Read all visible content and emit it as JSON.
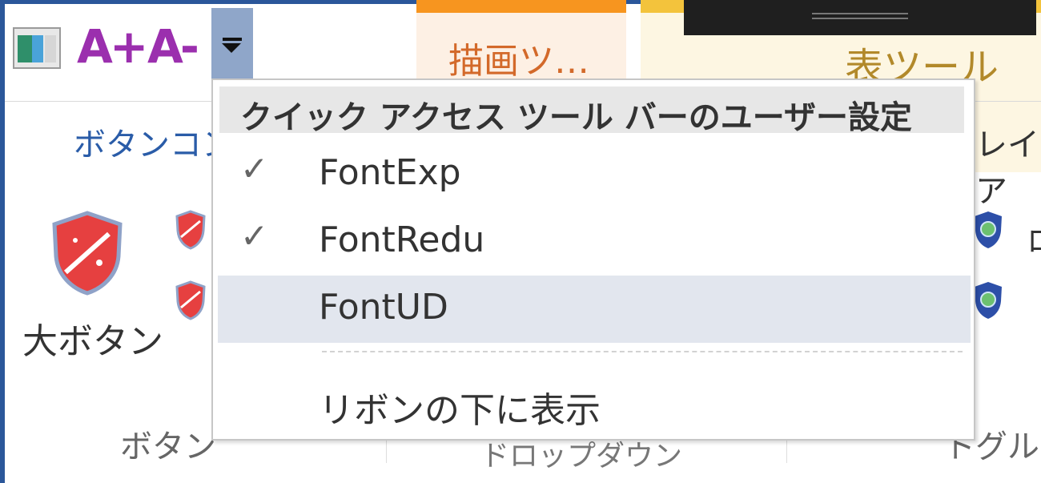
{
  "qat": {
    "font_expand_label": "A+",
    "font_reduce_label": "A-"
  },
  "contextual_tabs": {
    "drawing_tools": "描画ツ…",
    "table_tools": "表ツール"
  },
  "ribbon": {
    "tab_button_control": "ボタンコン",
    "tab_layout_partial": "レイア",
    "big_button_label": "大ボタン",
    "group_buttons_label": "ボタン",
    "group_dropdown_label": "ドロップダウン",
    "group_toggle_label": "トグル",
    "right_partial_text": "ロ"
  },
  "qat_menu": {
    "header": "クイック アクセス ツール バーのユーザー設定",
    "items": [
      {
        "label": "FontExp",
        "checked": true,
        "check_glyph": "✓"
      },
      {
        "label": "FontRedu",
        "checked": true,
        "check_glyph": "✓"
      },
      {
        "label": "FontUD",
        "checked": false,
        "check_glyph": ""
      }
    ],
    "show_below": "リボンの下に表示"
  },
  "colors": {
    "accent": "#2b579a",
    "qat_font_icon": "#9b2fae",
    "drawing_tools_stripe": "#f7951f",
    "table_tools_stripe": "#f3c33c",
    "menu_highlight": "#e2e6ee"
  }
}
